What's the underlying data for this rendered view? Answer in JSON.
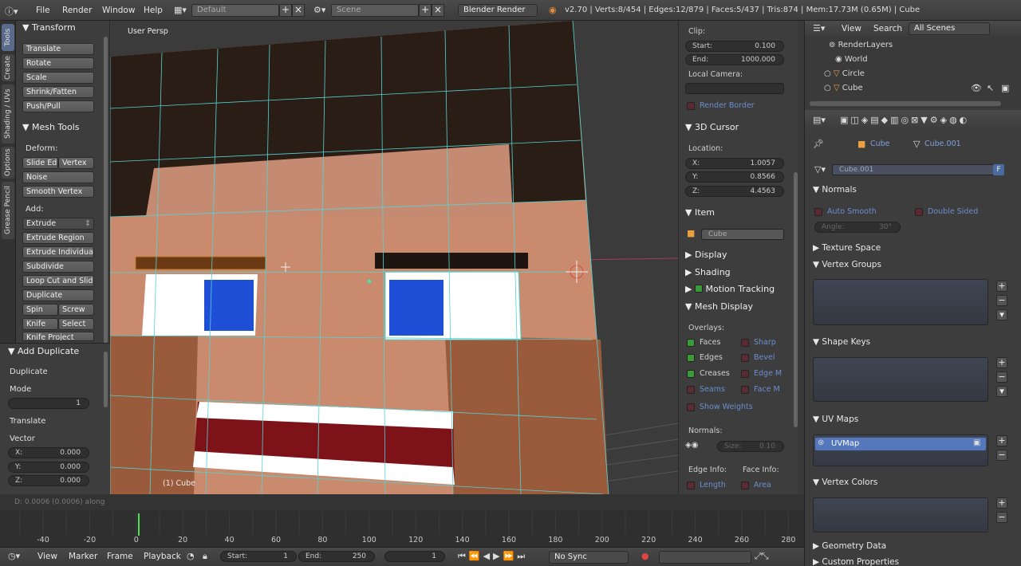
{
  "topbar": {
    "menus": [
      "File",
      "Render",
      "Window",
      "Help"
    ],
    "layout": "Default",
    "scene": "Scene",
    "engine": "Blender Render",
    "stats": "v2.70 | Verts:8/454 | Edges:12/879 | Faces:5/437 | Tris:874 | Mem:17.73M (0.65M) | Cube",
    "plus": "+",
    "close": "×"
  },
  "tabs": [
    "Tools",
    "Create",
    "Shading / UVs",
    "Options",
    "Grease Pencil"
  ],
  "toolshelf": {
    "transform_header": "Transform",
    "transform_buttons": [
      "Translate",
      "Rotate",
      "Scale",
      "Shrink/Fatten",
      "Push/Pull"
    ],
    "mesh_header": "Mesh Tools",
    "deform_label": "Deform:",
    "deform_row": [
      "Slide Ed",
      "Vertex"
    ],
    "noise": "Noise",
    "smooth_vertex": "Smooth Vertex",
    "add_label": "Add:",
    "extrude": "Extrude",
    "extrude_region": "Extrude Region",
    "extrude_individual": "Extrude Individual",
    "subdivide": "Subdivide",
    "loop_cut": "Loop Cut and Slide",
    "duplicate": "Duplicate",
    "spin_row": [
      "Spin",
      "Screw"
    ],
    "knife_row": [
      "Knife",
      "Select"
    ],
    "knife_project": "Knife Project"
  },
  "operator": {
    "header": "Add Duplicate",
    "duplicate": "Duplicate",
    "mode": "Mode",
    "mode_value": "1",
    "translate": "Translate",
    "vector": "Vector",
    "x_label": "X:",
    "x": "0.000",
    "y_label": "Y:",
    "y": "0.000",
    "z_label": "Z:",
    "z": "0.000"
  },
  "viewport": {
    "label": "User Persp",
    "object": "(1) Cube",
    "status": "D: 0.0006 (0.0006) along"
  },
  "npanel": {
    "clip": "Clip:",
    "start_label": "Start:",
    "start": "0.100",
    "end_label": "End:",
    "end": "1000.000",
    "local_camera": "Local Camera:",
    "render_border": "Render Border",
    "cursor_header": "3D Cursor",
    "location": "Location:",
    "cx_label": "X:",
    "cx": "1.0057",
    "cy_label": "Y:",
    "cy": "0.8566",
    "cz_label": "Z:",
    "cz": "4.4563",
    "item_header": "Item",
    "item_name": "Cube",
    "display": "Display",
    "shading": "Shading",
    "motion_tracking": "Motion Tracking",
    "mesh_display": "Mesh Display",
    "overlays": "Overlays:",
    "faces": "Faces",
    "sharp": "Sharp",
    "edges": "Edges",
    "bevel": "Bevel",
    "creases": "Creases",
    "edge_m": "Edge M",
    "seams": "Seams",
    "face_m": "Face M",
    "show_weights": "Show Weights",
    "normals": "Normals:",
    "size_label": "Size:",
    "size": "0.10",
    "edge_info": "Edge Info:",
    "face_info": "Face Info:",
    "length": "Length",
    "area": "Area"
  },
  "timeline": {
    "ticks": [
      "-40",
      "-20",
      "0",
      "20",
      "40",
      "60",
      "80",
      "100",
      "120",
      "140",
      "160",
      "180",
      "200",
      "220",
      "240",
      "260",
      "280"
    ],
    "current_frame": 1,
    "view": "View",
    "marker": "Marker",
    "frame": "Frame",
    "playback": "Playback",
    "start_label": "Start:",
    "start": "1",
    "end_label": "End:",
    "end": "250",
    "current": "1",
    "sync": "No Sync"
  },
  "outliner": {
    "view": "View",
    "search": "Search",
    "scenes": "All Scenes",
    "items": [
      "RenderLayers",
      "World",
      "Circle",
      "Cube"
    ]
  },
  "properties": {
    "obj": "Cube",
    "mesh": "Cube.001",
    "datablock": "Cube.001",
    "fake": "F",
    "normals": "Normals",
    "auto_smooth": "Auto Smooth",
    "double_sided": "Double Sided",
    "angle_label": "Angle:",
    "angle": "30°",
    "texture_space": "Texture Space",
    "vertex_groups": "Vertex Groups",
    "shape_keys": "Shape Keys",
    "uv_maps": "UV Maps",
    "uvmap": "UVMap",
    "vertex_colors": "Vertex Colors",
    "geometry_data": "Geometry Data",
    "custom_properties": "Custom Properties"
  },
  "colors": {
    "skin": "#c98a6e",
    "hair": "#2a1d15",
    "eye_blue": "#1e4fd6",
    "mouth": "#7d1219",
    "wire": "#54d4d4"
  }
}
